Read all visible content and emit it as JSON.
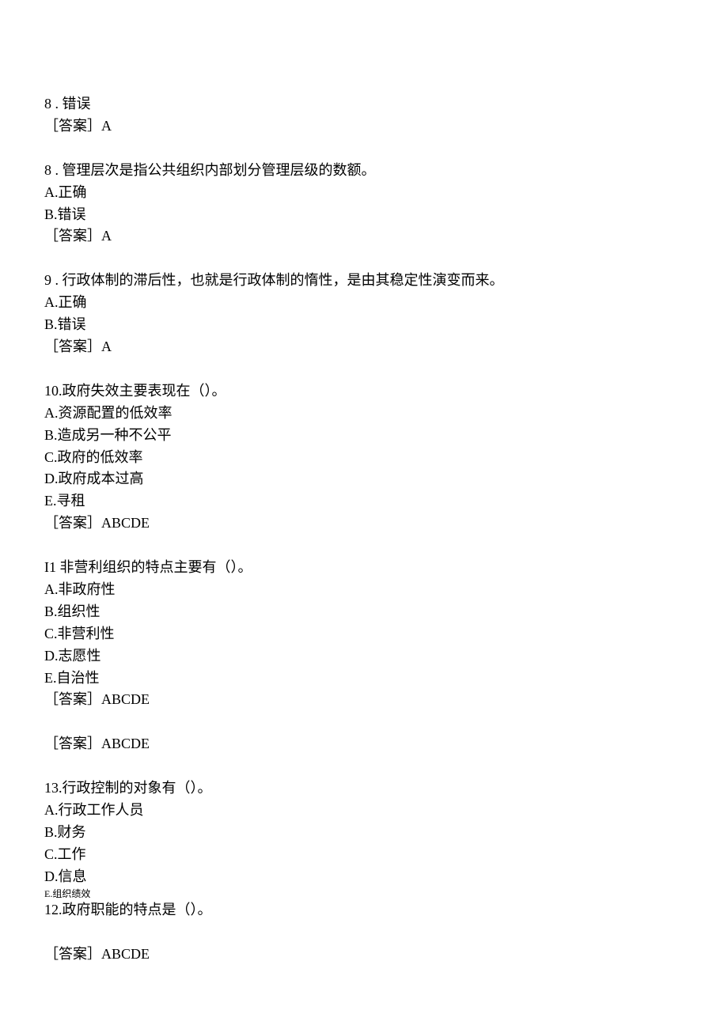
{
  "blocks": [
    {
      "lines": [
        "8 . 错误",
        "［答案］A"
      ]
    },
    {
      "lines": [
        "8 . 管理层次是指公共组织内部划分管理层级的数额。",
        "A.正确",
        "B.错误",
        "［答案］A"
      ]
    },
    {
      "lines": [
        "9 . 行政体制的滞后性，也就是行政体制的惰性，是由其稳定性演变而来。",
        "A.正确",
        "B.错误",
        "［答案］A"
      ]
    },
    {
      "lines": [
        "10.政府失效主要表现在（）。",
        "A.资源配置的低效率",
        "B.造成另一种不公平",
        "C.政府的低效率",
        "D.政府成本过高",
        "E.寻租",
        "［答案］ABCDE"
      ]
    },
    {
      "lines": [
        "I1 非营利组织的特点主要有（）。",
        "A.非政府性",
        "B.组织性",
        "C.非营利性",
        "D.志愿性",
        "E.自治性",
        "［答案］ABCDE"
      ]
    },
    {
      "lines": [
        "［答案］ABCDE"
      ]
    },
    {
      "lines": [
        "13.行政控制的对象有（）。",
        "A.行政工作人员",
        "B.财务",
        "C.工作",
        "D.信息",
        "E.组织绩效",
        "12.政府职能的特点是（）。"
      ],
      "small_line_index": 5
    },
    {
      "lines": [
        "［答案］ABCDE"
      ]
    }
  ]
}
